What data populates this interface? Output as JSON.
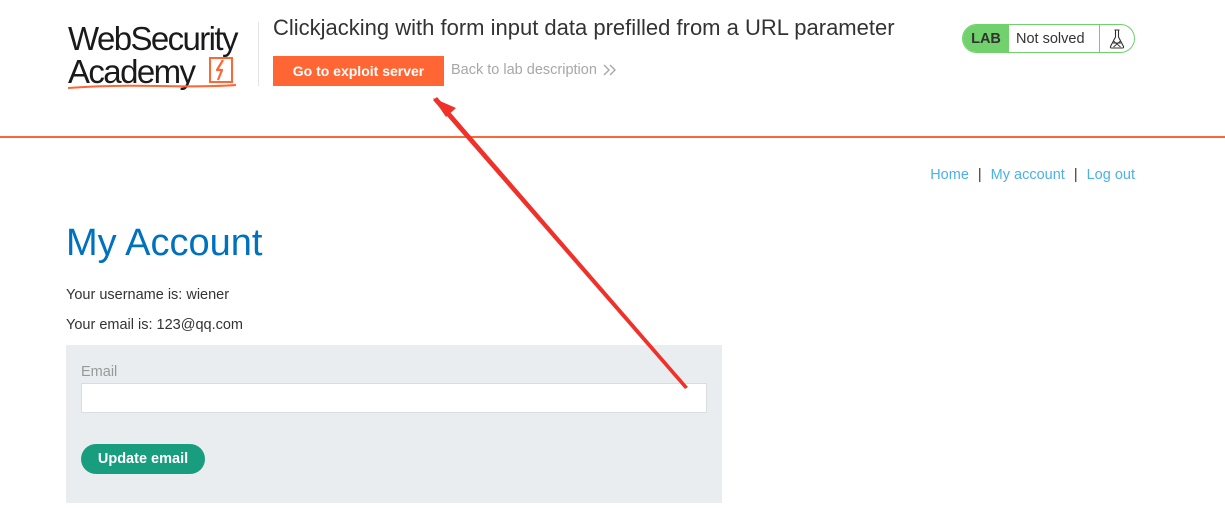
{
  "logo": {
    "line1": "WebSecurity",
    "line2": "Academy",
    "icon": "academy-flash-icon"
  },
  "header": {
    "lab_title": "Clickjacking with form input data prefilled from a URL parameter",
    "exploit_button": "Go to exploit server",
    "back_link": "Back to lab description",
    "back_icon": "double-chevron-right-icon"
  },
  "status": {
    "badge": "LAB",
    "text": "Not solved",
    "icon": "flask-icon",
    "badge_color": "#70d16d"
  },
  "nav": {
    "home": "Home",
    "my_account": "My account",
    "log_out": "Log out",
    "separator": "|"
  },
  "account": {
    "title": "My Account",
    "username_line": "Your username is: wiener",
    "email_line": "Your email is: 123@qq.com"
  },
  "form": {
    "email_label": "Email",
    "email_value": "",
    "email_placeholder": "",
    "submit_label": "Update email"
  },
  "colors": {
    "accent": "#ff6633",
    "link": "#4cb1e8",
    "title": "#0071bc",
    "submit": "#189d7f",
    "panel": "#e9edf0",
    "annotation_arrow": "#f0312a"
  }
}
